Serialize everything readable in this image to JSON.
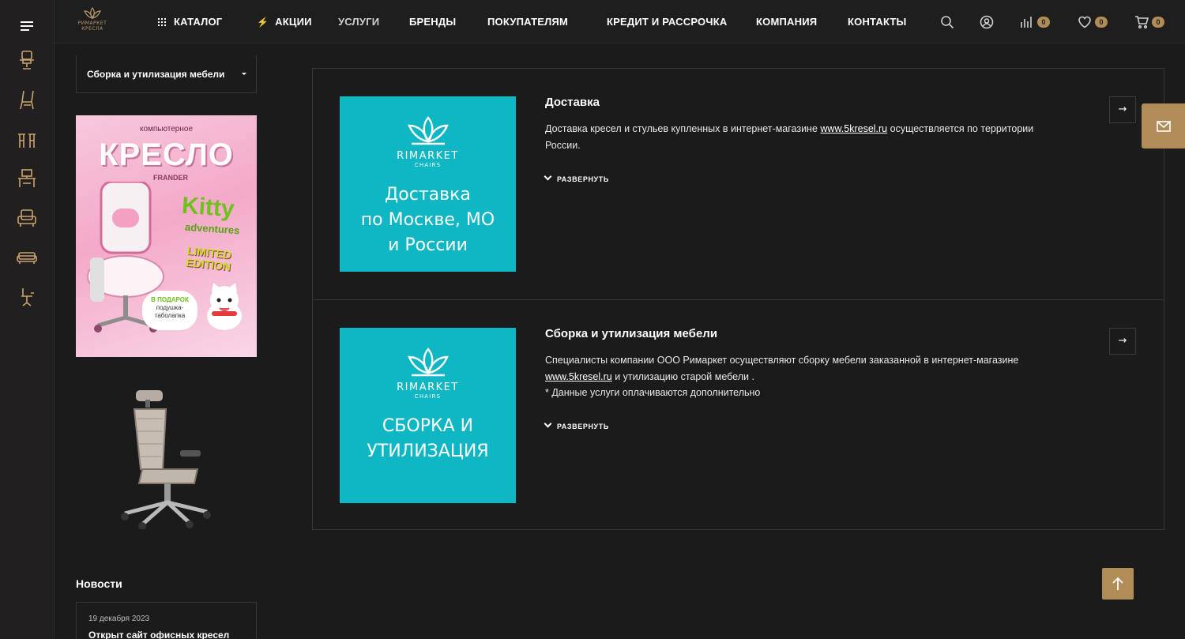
{
  "header": {
    "logo_text": "РИМАРКЕТ",
    "logo_sub": "КРЕСЛА",
    "nav": {
      "catalog": "КАТАЛОГ",
      "sales": "АКЦИИ",
      "services": "УСЛУГИ",
      "brands": "БРЕНДЫ",
      "buyers": "ПОКУПАТЕЛЯМ",
      "credit": "КРЕДИТ И РАССРОЧКА",
      "company": "КОМПАНИЯ",
      "contacts": "КОНТАКТЫ"
    },
    "counts": {
      "compare": "0",
      "favorites": "0",
      "cart": "0"
    }
  },
  "sidebar": {
    "select_label": "Сборка и утилизация мебели",
    "banner": {
      "small": "компьютерное",
      "title": "КРЕСЛО",
      "brand": "FRANDER",
      "kitty": "Kitty",
      "adventures": "adventures",
      "limited": "LIMITED EDITION",
      "gift_line1": "В ПОДАРОК",
      "gift_line2": "подушка-",
      "gift_line3": "таболапка"
    },
    "news": {
      "title": "Новости",
      "date": "19 декабря 2023",
      "item_title": "Открыт сайт офисных кресел"
    }
  },
  "services": [
    {
      "title": "Доставка",
      "text_before": "Доставка кресел и стульев купленных в интернет-магазине ",
      "link": "www.5kresel.ru",
      "text_after": " осуществляется по территории России.",
      "expand": "РАЗВЕРНУТЬ",
      "image": {
        "brand": "RIMARKET",
        "brand2": "CHAIRS",
        "caption": "Доставка\nпо Москве, МО\nи России"
      }
    },
    {
      "title": "Сборка и утилизация мебели",
      "text_before": "Специалисты компании ООО Римаркет осуществляют сборку мебели заказанной в интернет-магазине ",
      "link": "www.5kresel.ru",
      "text_after": " и утилизацию старой мебели .",
      "note": "* Данные услуги оплачиваются дополнительно",
      "expand": "РАЗВЕРНУТЬ",
      "image": {
        "brand": "RIMARKET",
        "brand2": "CHAIRS",
        "caption": "СБОРКА И\nУТИЛИЗАЦИЯ"
      }
    }
  ],
  "colors": {
    "accent": "#b08d57",
    "teal": "#0fb6c3",
    "bg": "#1c1b1b"
  }
}
